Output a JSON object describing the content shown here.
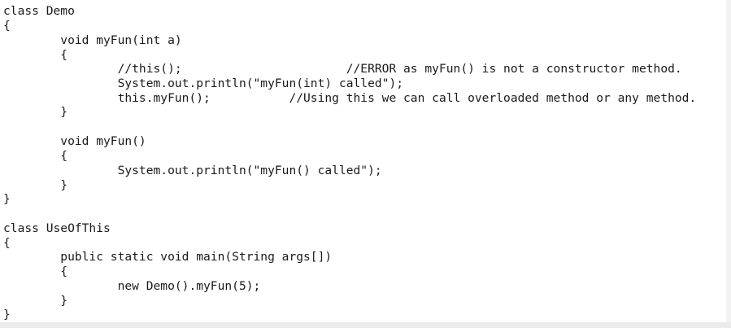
{
  "code": {
    "lines": [
      "class Demo",
      "{",
      "        void myFun(int a)",
      "        {",
      "                //this();                       //ERROR as myFun() is not a constructor method.",
      "                System.out.println(\"myFun(int) called\");",
      "                this.myFun();           //Using this we can call overloaded method or any method.",
      "        }",
      "",
      "        void myFun()",
      "        {",
      "                System.out.println(\"myFun() called\");",
      "        }",
      "}",
      "",
      "class UseOfThis",
      "{",
      "        public static void main(String args[])",
      "        {",
      "                new Demo().myFun(5);",
      "        }",
      "}"
    ]
  }
}
